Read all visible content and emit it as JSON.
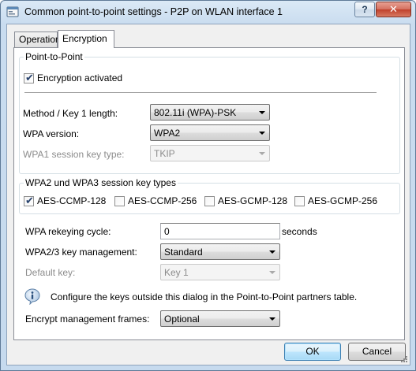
{
  "window": {
    "title": "Common point-to-point settings - P2P on WLAN interface 1",
    "help_label": "?",
    "close_label": "✕"
  },
  "tabs": [
    {
      "label": "Operation",
      "selected": false
    },
    {
      "label": "Encryption",
      "selected": true
    }
  ],
  "point_to_point": {
    "group_title": "Point-to-Point",
    "encryption_activated": {
      "label": "Encryption activated",
      "checked": true
    }
  },
  "method": {
    "label": "Method / Key 1 length:",
    "value": "802.11i (WPA)-PSK"
  },
  "wpa_version": {
    "label": "WPA version:",
    "value": "WPA2"
  },
  "wpa1_session_key_type": {
    "label": "WPA1 session key type:",
    "value": "TKIP",
    "disabled": true
  },
  "session_key_types": {
    "group_title": "WPA2 und WPA3 session key types",
    "items": [
      {
        "label": "AES-CCMP-128",
        "checked": true
      },
      {
        "label": "AES-CCMP-256",
        "checked": false
      },
      {
        "label": "AES-GCMP-128",
        "checked": false
      },
      {
        "label": "AES-GCMP-256",
        "checked": false
      }
    ]
  },
  "rekeying": {
    "label": "WPA rekeying cycle:",
    "value": "0",
    "unit": "seconds"
  },
  "key_management": {
    "label": "WPA2/3 key management:",
    "value": "Standard"
  },
  "default_key": {
    "label": "Default key:",
    "value": "Key 1",
    "disabled": true
  },
  "info": {
    "text": "Configure the keys outside this dialog in the Point-to-Point partners table."
  },
  "management_frames": {
    "label": "Encrypt management frames:",
    "value": "Optional"
  },
  "buttons": {
    "ok": "OK",
    "cancel": "Cancel"
  },
  "colors": {
    "accent": "#3c7fb1",
    "title_gradient": "#c9dcef"
  }
}
